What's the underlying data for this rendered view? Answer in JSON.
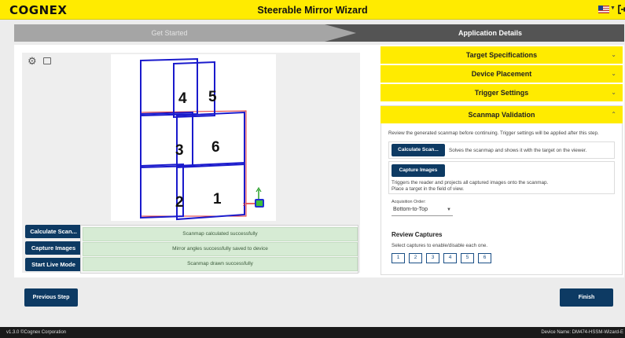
{
  "header": {
    "logo": "COGNEX",
    "title": "Steerable Mirror Wizard"
  },
  "stepper": {
    "step1": "Get Started",
    "step2": "Application Details"
  },
  "viewer": {
    "targets": [
      {
        "label": "1"
      },
      {
        "label": "2"
      },
      {
        "label": "3"
      },
      {
        "label": "4"
      },
      {
        "label": "5"
      },
      {
        "label": "6"
      }
    ]
  },
  "actions": {
    "calculate": "Calculate Scan...",
    "capture": "Capture Images",
    "live": "Start Live Mode",
    "messages": [
      "Scanmap calculated successfully",
      "Mirror angles successfully saved to device",
      "Scanmap drawn successfully"
    ]
  },
  "accordion": {
    "target_spec": "Target Specifications",
    "device_placement": "Device Placement",
    "trigger": "Trigger Settings",
    "scanmap": "Scanmap Validation"
  },
  "scanmap": {
    "intro": "Review the generated scanmap before continuing. Trigger settings will be applied after this step.",
    "calc_btn": "Calculate Scan...",
    "calc_desc": "Solves the scanmap and shows it with the target on the viewer.",
    "capture_btn": "Capture Images",
    "capture_desc1": "Triggers the reader and projects all captured images onto the scanmap.",
    "capture_desc2": "Place a target in the field of view.",
    "acq_label": "Acquisition Order:",
    "acq_value": "Bottom-to-Top",
    "review_title": "Review Captures",
    "review_desc": "Select captures to enable/disable each one.",
    "captures": [
      "1",
      "2",
      "3",
      "4",
      "5",
      "6"
    ]
  },
  "nav": {
    "prev": "Previous Step",
    "finish": "Finish"
  },
  "footer": {
    "version": "v1.3.0 ©Cognex Corporation",
    "device": "Device Name: DM474-HSSM-Wizard-E"
  }
}
